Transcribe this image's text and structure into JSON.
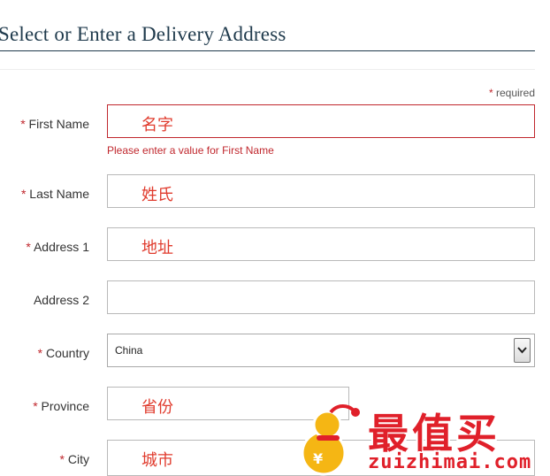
{
  "page": {
    "title": "Select or Enter a Delivery Address",
    "required_star": "*",
    "required_note": "required"
  },
  "form": {
    "first_name": {
      "star": "*",
      "label": "First Name",
      "value": "名字",
      "error": "Please enter a value for First Name"
    },
    "last_name": {
      "star": "*",
      "label": "Last Name",
      "value": "姓氏"
    },
    "address1": {
      "star": "*",
      "label": "Address 1",
      "value": "地址"
    },
    "address2": {
      "label": "Address 2",
      "value": ""
    },
    "country": {
      "star": "*",
      "label": "Country",
      "selected": "China"
    },
    "province": {
      "star": "*",
      "label": "Province",
      "value": "省份"
    },
    "city": {
      "star": "*",
      "label": "City",
      "value": "城市"
    }
  },
  "watermark": {
    "logo_text": "最值买",
    "url": "zuizhimai.com",
    "icon": "gourd-mascot-icon"
  },
  "colors": {
    "title": "#1f3a4c",
    "required": "#c0272d",
    "entered_text": "#e03b2d",
    "watermark": "#e0202a"
  }
}
